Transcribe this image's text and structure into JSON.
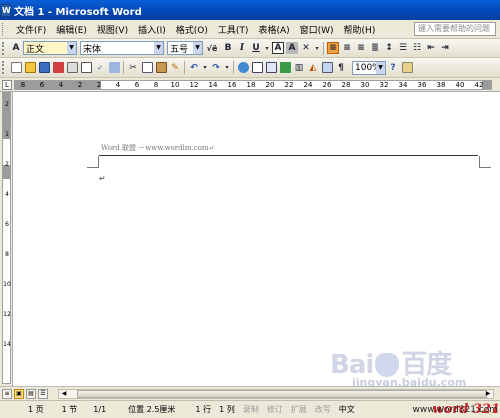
{
  "window": {
    "title": "文档 1 - Microsoft Word",
    "app_icon_char": "W"
  },
  "menu": {
    "items": [
      "文件(F)",
      "编辑(E)",
      "视图(V)",
      "插入(I)",
      "格式(O)",
      "工具(T)",
      "表格(A)",
      "窗口(W)",
      "帮助(H)"
    ],
    "help_placeholder": "键入需要帮助的问题"
  },
  "toolbar1": {
    "style": "正文",
    "font": "宋体",
    "size": "五号",
    "bold": "B",
    "italic": "I",
    "underline": "U",
    "char_border": "A",
    "char_shade": "A"
  },
  "toolbar2": {
    "zoom": "100%"
  },
  "ruler": {
    "h_numbers": [
      "8",
      "6",
      "4",
      "2",
      "2",
      "4",
      "6",
      "8",
      "10",
      "12",
      "14",
      "16",
      "18",
      "20",
      "22",
      "24",
      "26",
      "28",
      "30",
      "32",
      "34",
      "36",
      "38",
      "40",
      "42"
    ],
    "v_numbers": [
      "2",
      "1",
      "2",
      "4",
      "6",
      "8",
      "10",
      "12",
      "14"
    ]
  },
  "document": {
    "header_text": "Word 联盟 －www.wordlm.com↵",
    "cursor_mark": "↵"
  },
  "status": {
    "page": "1 页",
    "section": "1 节",
    "page_of": "1/1",
    "position": "位置 2.5厘米",
    "line": "1 行",
    "column": "1 列",
    "rec": "录制",
    "trk": "修订",
    "ext": "扩展",
    "ovr": "改写",
    "lang": "中文",
    "watermark_logo": "word 321",
    "watermark_site": "www.word321.com"
  },
  "watermark": {
    "brand": "Bai",
    "brand2": "百度",
    "sub": "jingyan.baidu.com"
  },
  "colors": {
    "title_bar": "#0a5fd8",
    "chrome": "#ece9d8",
    "doc_bg": "#ffffff",
    "watermark_red": "#d8232a"
  }
}
